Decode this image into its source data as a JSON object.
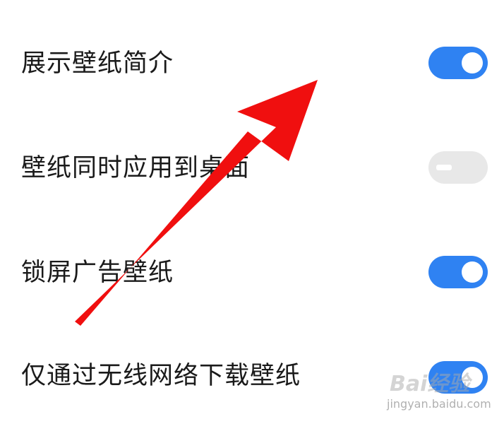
{
  "settings": [
    {
      "label": "展示壁纸简介",
      "toggle_state": "on"
    },
    {
      "label": "壁纸同时应用到桌面",
      "toggle_state": "off"
    },
    {
      "label": "锁屏广告壁纸",
      "toggle_state": "on"
    },
    {
      "label": "仅通过无线网络下载壁纸",
      "toggle_state": "on"
    }
  ],
  "colors": {
    "toggle_on": "#2f82f2",
    "toggle_off": "#e8e8e8",
    "arrow": "#f00f0f"
  },
  "watermark": {
    "logo_text": "Bai经验",
    "url_text": "jingyan.baidu.com"
  }
}
